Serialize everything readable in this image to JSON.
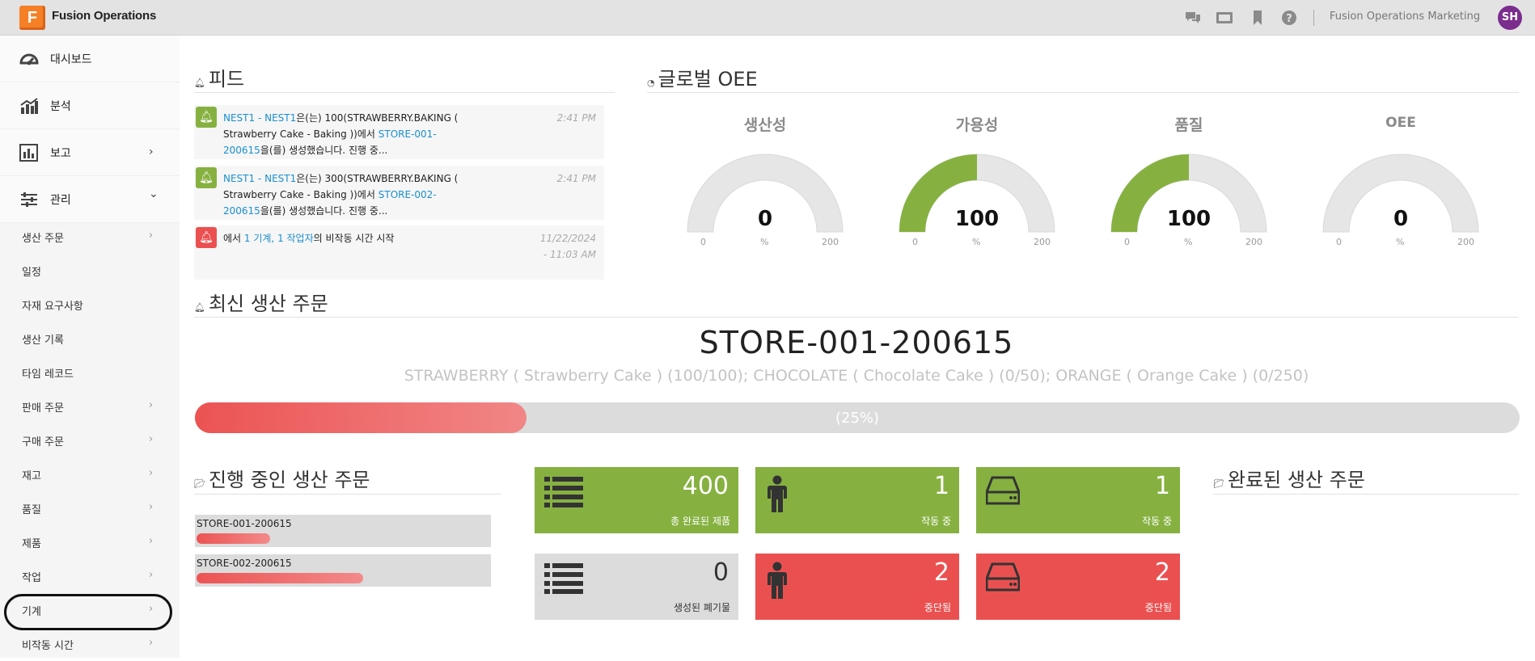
{
  "app": {
    "logo_letter": "F",
    "title": "Fusion Operations",
    "org": "Fusion Operations Marketing",
    "avatar": "SH"
  },
  "sidebar": {
    "main": [
      {
        "label": "대시보드",
        "icon": "dashboard-gauge-icon"
      },
      {
        "label": "분석",
        "icon": "analytics-chart-icon"
      },
      {
        "label": "보고",
        "icon": "report-bar-chart-icon",
        "chevron": "›"
      },
      {
        "label": "관리",
        "icon": "manage-sliders-icon",
        "chevron": "⌄"
      }
    ],
    "sub": [
      {
        "label": "생산 주문",
        "chevron": "›"
      },
      {
        "label": "일정",
        "chevron": ""
      },
      {
        "label": "자재 요구사항",
        "chevron": ""
      },
      {
        "label": "생산 기록",
        "chevron": ""
      },
      {
        "label": "타임 레코드",
        "chevron": ""
      },
      {
        "label": "판매 주문",
        "chevron": "›"
      },
      {
        "label": "구매 주문",
        "chevron": "›"
      },
      {
        "label": "재고",
        "chevron": "›"
      },
      {
        "label": "품질",
        "chevron": "›"
      },
      {
        "label": "제품",
        "chevron": "›"
      },
      {
        "label": "작업",
        "chevron": "›"
      },
      {
        "label": "기계",
        "chevron": "›"
      },
      {
        "label": "비작동 시간",
        "chevron": "›"
      }
    ]
  },
  "feed": {
    "title": "피드",
    "items": [
      {
        "status": "green",
        "link1": "NEST1 - NEST1",
        "t1": "은(는) 100(STRAWBERRY.BAKING ( Strawberry Cake - Baking ))에서 ",
        "link2": "STORE-001-200615",
        "t2": "을(를) 생성했습니다. 진행 중...",
        "time": "2:41 PM"
      },
      {
        "status": "green",
        "link1": "NEST1 - NEST1",
        "t1": "은(는) 300(STRAWBERRY.BAKING ( Strawberry Cake - Baking ))에서 ",
        "link2": "STORE-002-200615",
        "t2": "을(를) 생성했습니다. 진행 중...",
        "time": "2:41 PM"
      },
      {
        "status": "red",
        "t0": "에서 ",
        "link1": "1 기계, 1 작업자",
        "t1": "의 비작동 시간 시작",
        "time": "11/22/2024 - 11:03 AM"
      }
    ]
  },
  "oee": {
    "title": "글로벌 OEE",
    "gauges": [
      {
        "label": "생산성",
        "value": "0",
        "min": "0",
        "max": "200",
        "unit": "%",
        "fraction": 0
      },
      {
        "label": "가용성",
        "value": "100",
        "min": "0",
        "max": "200",
        "unit": "%",
        "fraction": 0.5
      },
      {
        "label": "품질",
        "value": "100",
        "min": "0",
        "max": "200",
        "unit": "%",
        "fraction": 0.5
      },
      {
        "label": "OEE",
        "value": "0",
        "min": "0",
        "max": "200",
        "unit": "%",
        "fraction": 0
      }
    ]
  },
  "latest_order": {
    "title": "최신 생산 주문",
    "name": "STORE-001-200615",
    "description": "STRAWBERRY ( Strawberry Cake ) (100/100); CHOCOLATE ( Chocolate Cake ) (0/50); ORANGE ( Orange Cake ) (0/250)",
    "progress_text": "(25%)",
    "progress": 0.25
  },
  "in_progress": {
    "title": "진행 중인 생산 주문",
    "orders": [
      {
        "name": "STORE-001-200615",
        "progress": 0.25
      },
      {
        "name": "STORE-002-200615",
        "progress": 0.57
      }
    ]
  },
  "tiles": [
    {
      "value": "400",
      "label": "총 완료된 제품",
      "icon": "list-icon",
      "color": "green"
    },
    {
      "value": "1",
      "label": "작동 중",
      "icon": "person-icon",
      "color": "green"
    },
    {
      "value": "1",
      "label": "작동 중",
      "icon": "machine-drive-icon",
      "color": "green"
    },
    {
      "value": "0",
      "label": "생성된 폐기물",
      "icon": "list-icon",
      "color": "gray"
    },
    {
      "value": "2",
      "label": "중단됨",
      "icon": "person-icon",
      "color": "red"
    },
    {
      "value": "2",
      "label": "중단됨",
      "icon": "machine-drive-icon",
      "color": "red"
    }
  ],
  "completed": {
    "title": "완료된 생산 주문"
  },
  "colors": {
    "green": "#86b140",
    "red": "#eb5050",
    "accent_link": "#1a8fcf",
    "gauge_track": "#e6e6e6"
  }
}
